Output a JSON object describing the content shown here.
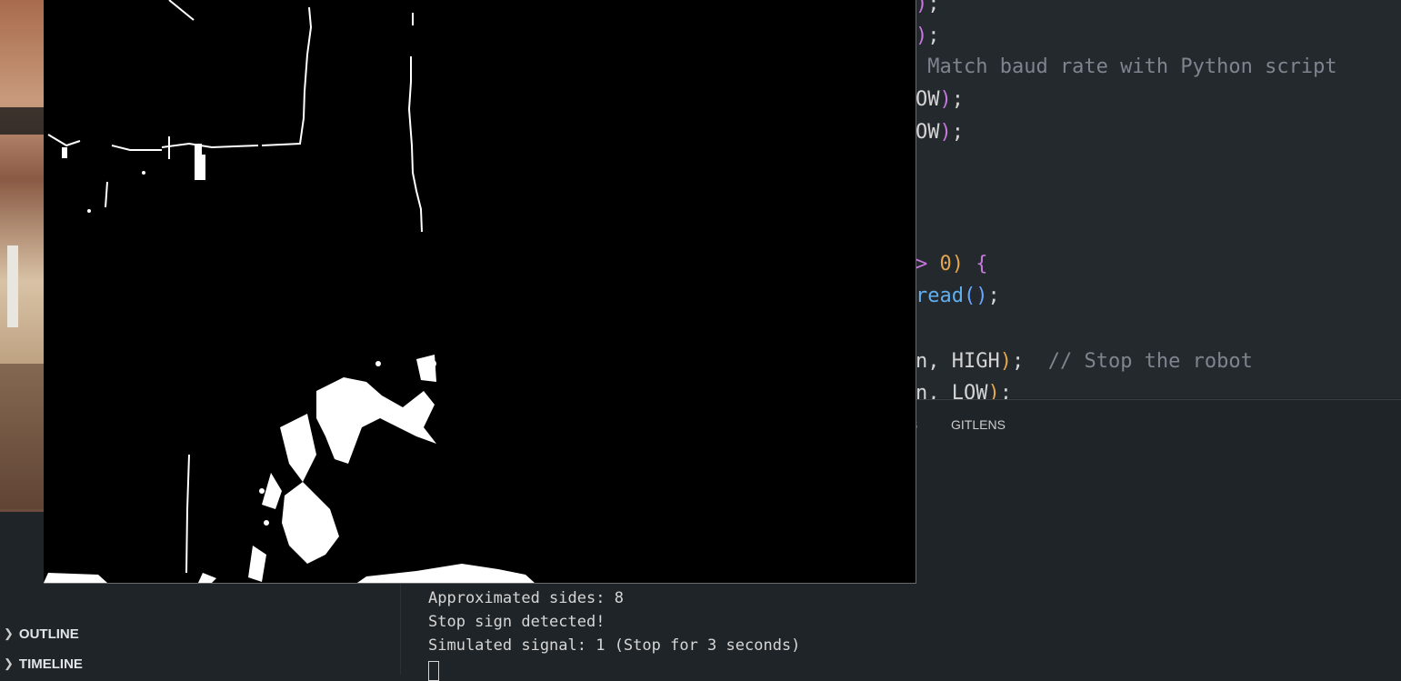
{
  "editor": {
    "lines": [
      {
        "segments": [
          {
            "text": ")",
            "cls": "p"
          },
          {
            "text": ";",
            "cls": "t"
          }
        ]
      },
      {
        "segments": [
          {
            "text": ")",
            "cls": "p"
          },
          {
            "text": ";",
            "cls": "t"
          }
        ]
      },
      {
        "segments": [
          {
            "text": " Match baud rate with Python script",
            "cls": "c"
          }
        ]
      },
      {
        "segments": [
          {
            "text": "OW",
            "cls": "t"
          },
          {
            "text": ")",
            "cls": "p"
          },
          {
            "text": ";",
            "cls": "t"
          }
        ]
      },
      {
        "segments": [
          {
            "text": "OW",
            "cls": "t"
          },
          {
            "text": ")",
            "cls": "p"
          },
          {
            "text": ";",
            "cls": "t"
          }
        ]
      },
      {
        "segments": [
          {
            "text": "> ",
            "cls": "p"
          },
          {
            "text": "0",
            "cls": "n"
          },
          {
            "text": ") ",
            "cls": "o"
          },
          {
            "text": "{",
            "cls": "p"
          }
        ]
      },
      {
        "segments": [
          {
            "text": "read",
            "cls": "f"
          },
          {
            "text": "()",
            "cls": "b"
          },
          {
            "text": ";",
            "cls": "t"
          }
        ]
      },
      {
        "segments": [
          {
            "text": "n, HIGH",
            "cls": "t"
          },
          {
            "text": ")",
            "cls": "o"
          },
          {
            "text": ";  ",
            "cls": "t"
          },
          {
            "text": "// Stop the robot",
            "cls": "c"
          }
        ]
      },
      {
        "segments": [
          {
            "text": "n, LOW",
            "cls": "t"
          },
          {
            "text": ")",
            "cls": "o"
          },
          {
            "text": ";",
            "cls": "t"
          }
        ]
      }
    ]
  },
  "panel": {
    "partial_tab": "S",
    "gitlens_tab": "GITLENS"
  },
  "terminal": {
    "lines": [
      "Approximated sides: 8",
      "Stop sign detected!",
      "Simulated signal: 1 (Stop for 3 seconds)"
    ]
  },
  "sidebar": {
    "outline": "OUTLINE",
    "timeline": "TIMELINE"
  },
  "icons": {
    "chevron": "chevron-right-icon"
  }
}
